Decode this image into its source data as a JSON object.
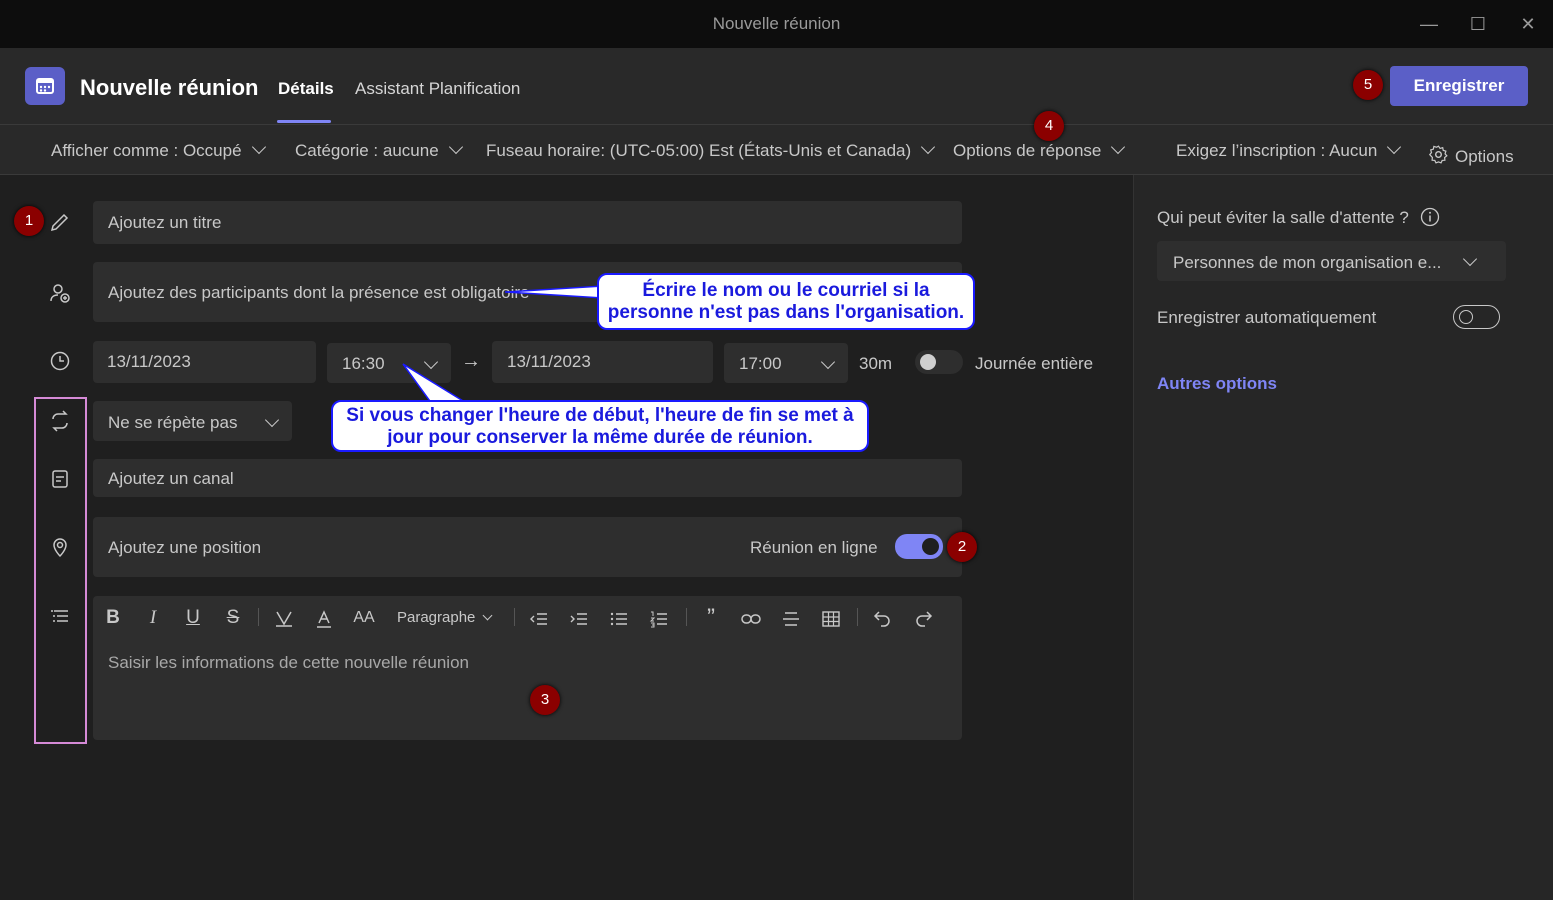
{
  "window": {
    "title": "Nouvelle réunion"
  },
  "header": {
    "title": "Nouvelle réunion",
    "tabs": [
      {
        "label": "Détails"
      },
      {
        "label": "Assistant Planification"
      }
    ],
    "save_label": "Enregistrer"
  },
  "toolbar": {
    "show_as": "Afficher comme : Occupé",
    "category": "Catégorie : aucune",
    "timezone": "Fuseau horaire: (UTC-05:00) Est (États-Unis et Canada)",
    "response_options": "Options de réponse",
    "registration": "Exigez l’inscription : Aucun",
    "options": "Options"
  },
  "form": {
    "title_placeholder": "Ajoutez un titre",
    "attendees_placeholder": "Ajoutez des participants dont la présence est obligatoire",
    "start_date": "13/11/2023",
    "start_time": "16:30",
    "end_date": "13/11/2023",
    "end_time": "17:00",
    "duration": "30m",
    "all_day_label": "Journée entière",
    "recurrence": "Ne se répète pas",
    "channel_placeholder": "Ajoutez un canal",
    "location_placeholder": "Ajoutez une position",
    "online_meeting_label": "Réunion en ligne",
    "online_meeting_on": true,
    "all_day_on": false
  },
  "editor": {
    "paragraph_label": "Paragraphe",
    "placeholder": "Saisir les informations de cette nouvelle réunion"
  },
  "right_panel": {
    "lobby_question": "Qui peut éviter la salle d'attente ?",
    "lobby_value": "Personnes de mon organisation e...",
    "auto_record_label": "Enregistrer automatiquement",
    "auto_record_on": false,
    "more_options": "Autres options"
  },
  "annotations": {
    "badges": [
      "1",
      "2",
      "3",
      "4",
      "5"
    ],
    "callout_attendees": "Écrire le nom ou le courriel si la personne n'est pas dans l'organisation.",
    "callout_time": "Si vous changer l'heure de début, l'heure de fin se met à jour pour conserver la même durée de réunion."
  },
  "colors": {
    "accent": "#5b5fc7",
    "badge": "#8b0000",
    "callout_text": "#1a1add",
    "highlight": "#d58ad6"
  }
}
